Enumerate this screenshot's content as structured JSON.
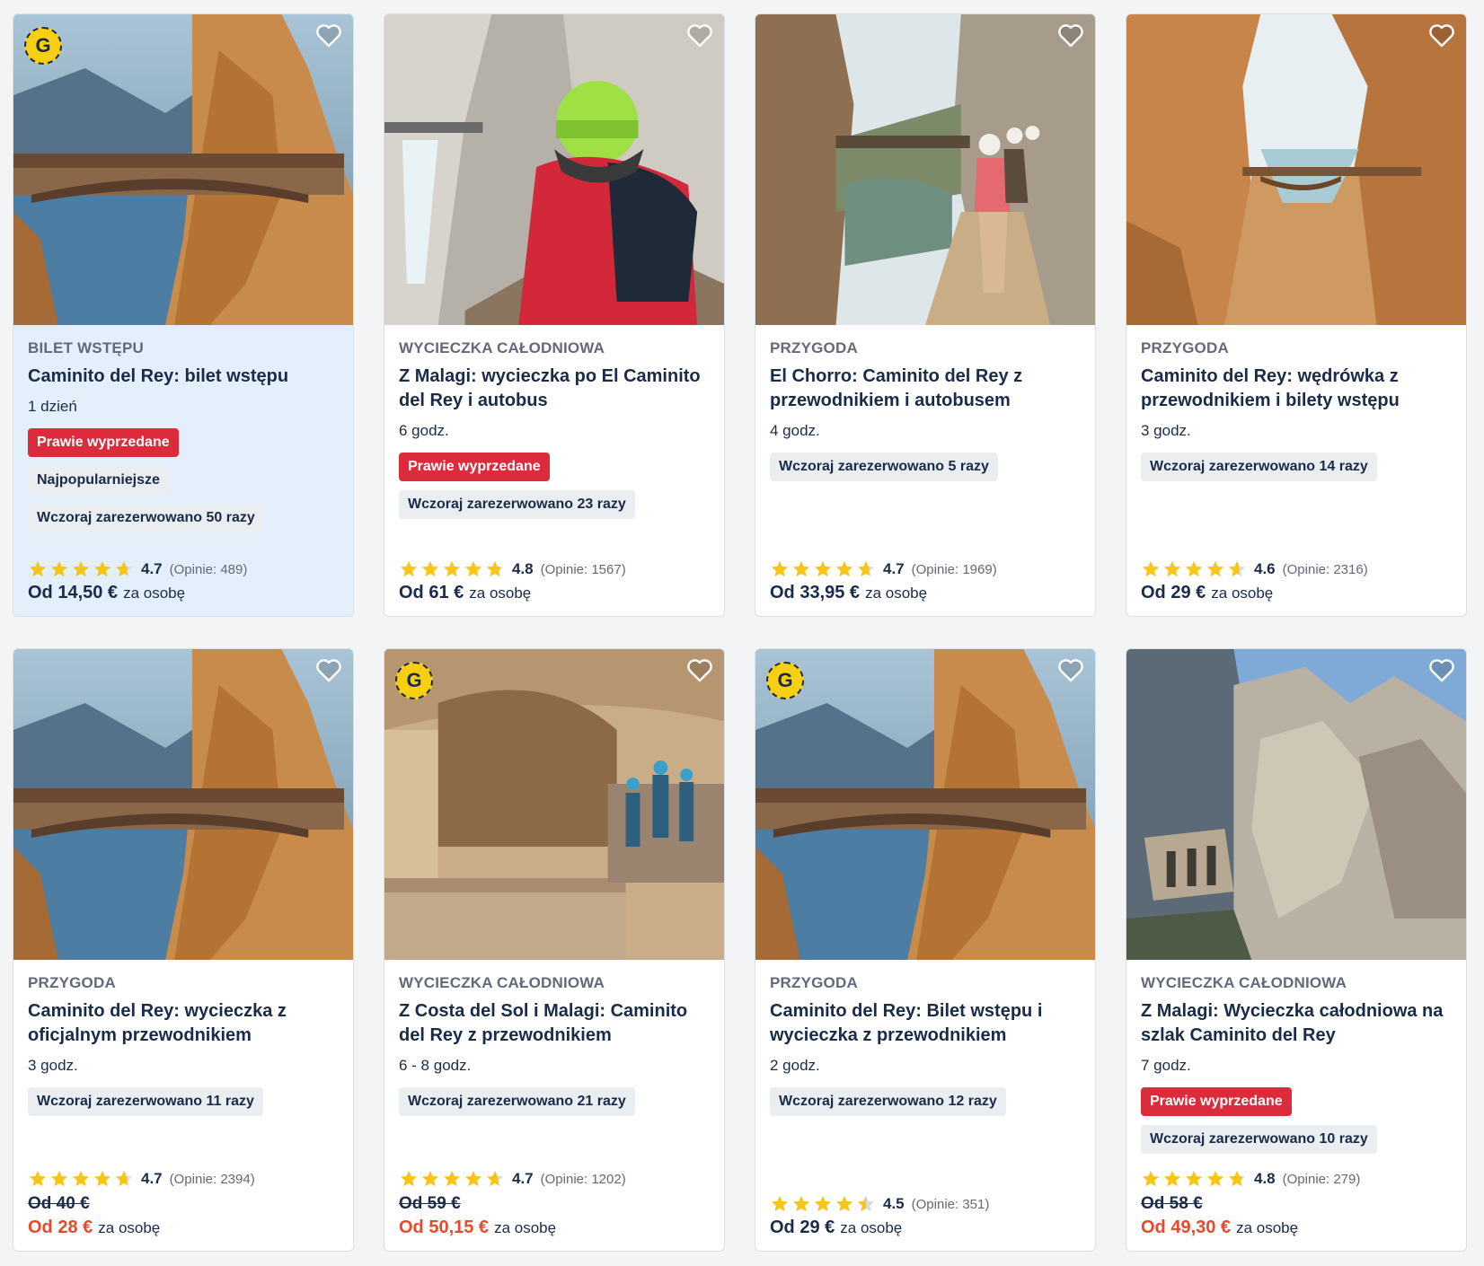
{
  "cards": [
    {
      "category": "BILET WSTĘPU",
      "title": "Caminito del Rey: bilet wstępu",
      "duration": "1 dzień",
      "tags": [
        "Prawie wyprzedane",
        "Najpopularniejsze",
        "Wczoraj zarezerwowano 50 razy"
      ],
      "hot_tag": true,
      "rating": "4.7",
      "rating_value": 4.7,
      "reviews": "(Opinie: 489)",
      "old_price": "",
      "price": "Od 14,50 €",
      "per": "za osobę",
      "sale": false,
      "highlight": true,
      "getyourguide_badge": true,
      "photo_icon": "bridge-canyon-photo"
    },
    {
      "category": "WYCIECZKA CAŁODNIOWA",
      "title": "Z Malagi: wycieczka po El Caminito del Rey i autobus",
      "duration": "6 godz.",
      "tags": [
        "Prawie wyprzedane",
        "Wczoraj zarezerwowano 23 razy"
      ],
      "hot_tag": true,
      "rating": "4.8",
      "rating_value": 4.8,
      "reviews": "(Opinie: 1567)",
      "old_price": "",
      "price": "Od 61 €",
      "per": "za osobę",
      "sale": false,
      "highlight": false,
      "getyourguide_badge": false,
      "photo_icon": "hiker-helmet-photo"
    },
    {
      "category": "PRZYGODA",
      "title": "El Chorro: Caminito del Rey z przewodnikiem i autobusem",
      "duration": "4 godz.",
      "tags": [
        "Wczoraj zarezerwowano 5 razy"
      ],
      "hot_tag": false,
      "rating": "4.7",
      "rating_value": 4.7,
      "reviews": "(Opinie: 1969)",
      "old_price": "",
      "price": "Od 33,95 €",
      "per": "za osobę",
      "sale": false,
      "highlight": false,
      "getyourguide_badge": false,
      "photo_icon": "boardwalk-hikers-photo"
    },
    {
      "category": "PRZYGODA",
      "title": "Caminito del Rey: wędrówka z przewodnikiem i bilety wstępu",
      "duration": "3 godz.",
      "tags": [
        "Wczoraj zarezerwowano 14 razy"
      ],
      "hot_tag": false,
      "rating": "4.6",
      "rating_value": 4.6,
      "reviews": "(Opinie: 2316)",
      "old_price": "",
      "price": "Od 29 €",
      "per": "za osobę",
      "sale": false,
      "highlight": false,
      "getyourguide_badge": false,
      "photo_icon": "gorge-bridge-photo"
    },
    {
      "category": "PRZYGODA",
      "title": "Caminito del Rey: wycieczka z oficjalnym przewodnikiem",
      "duration": "3 godz.",
      "tags": [
        "Wczoraj zarezerwowano 11 razy"
      ],
      "hot_tag": false,
      "rating": "4.7",
      "rating_value": 4.7,
      "reviews": "(Opinie: 2394)",
      "old_price": "Od 40 €",
      "price": "Od 28 €",
      "per": "za osobę",
      "sale": true,
      "highlight": false,
      "getyourguide_badge": false,
      "photo_icon": "bridge-canyon-photo"
    },
    {
      "category": "WYCIECZKA CAŁODNIOWA",
      "title": "Z Costa del Sol i Malagi: Caminito del Rey z przewodnikiem",
      "duration": "6 - 8 godz.",
      "tags": [
        "Wczoraj zarezerwowano 21 razy"
      ],
      "hot_tag": false,
      "rating": "4.7",
      "rating_value": 4.7,
      "reviews": "(Opinie: 1202)",
      "old_price": "Od 59 €",
      "price": "Od 50,15 €",
      "per": "za osobę",
      "sale": true,
      "highlight": false,
      "getyourguide_badge": true,
      "photo_icon": "cave-walkway-photo"
    },
    {
      "category": "PRZYGODA",
      "title": "Caminito del Rey: Bilet wstępu i wycieczka z przewodnikiem",
      "duration": "2 godz.",
      "tags": [
        "Wczoraj zarezerwowano 12 razy"
      ],
      "hot_tag": false,
      "rating": "4.5",
      "rating_value": 4.5,
      "reviews": "(Opinie: 351)",
      "old_price": "",
      "price": "Od 29 €",
      "per": "za osobę",
      "sale": false,
      "highlight": false,
      "getyourguide_badge": true,
      "photo_icon": "bridge-canyon-photo"
    },
    {
      "category": "WYCIECZKA CAŁODNIOWA",
      "title": "Z Malagi: Wycieczka całodniowa na szlak Caminito del Rey",
      "duration": "7 godz.",
      "tags": [
        "Prawie wyprzedane",
        "Wczoraj zarezerwowano 10 razy"
      ],
      "hot_tag": true,
      "rating": "4.8",
      "rating_value": 4.8,
      "reviews": "(Opinie: 279)",
      "old_price": "Od 58 €",
      "price": "Od 49,30 €",
      "per": "za osobę",
      "sale": true,
      "highlight": false,
      "getyourguide_badge": false,
      "photo_icon": "rock-cliff-photo"
    }
  ],
  "getyourguide_badge_letter": "G",
  "colors": {
    "hot_tag": "#dc2c3c",
    "sale_price": "#e8492a",
    "star": "#f6c518",
    "highlight_bg": "#e3f0fc"
  }
}
